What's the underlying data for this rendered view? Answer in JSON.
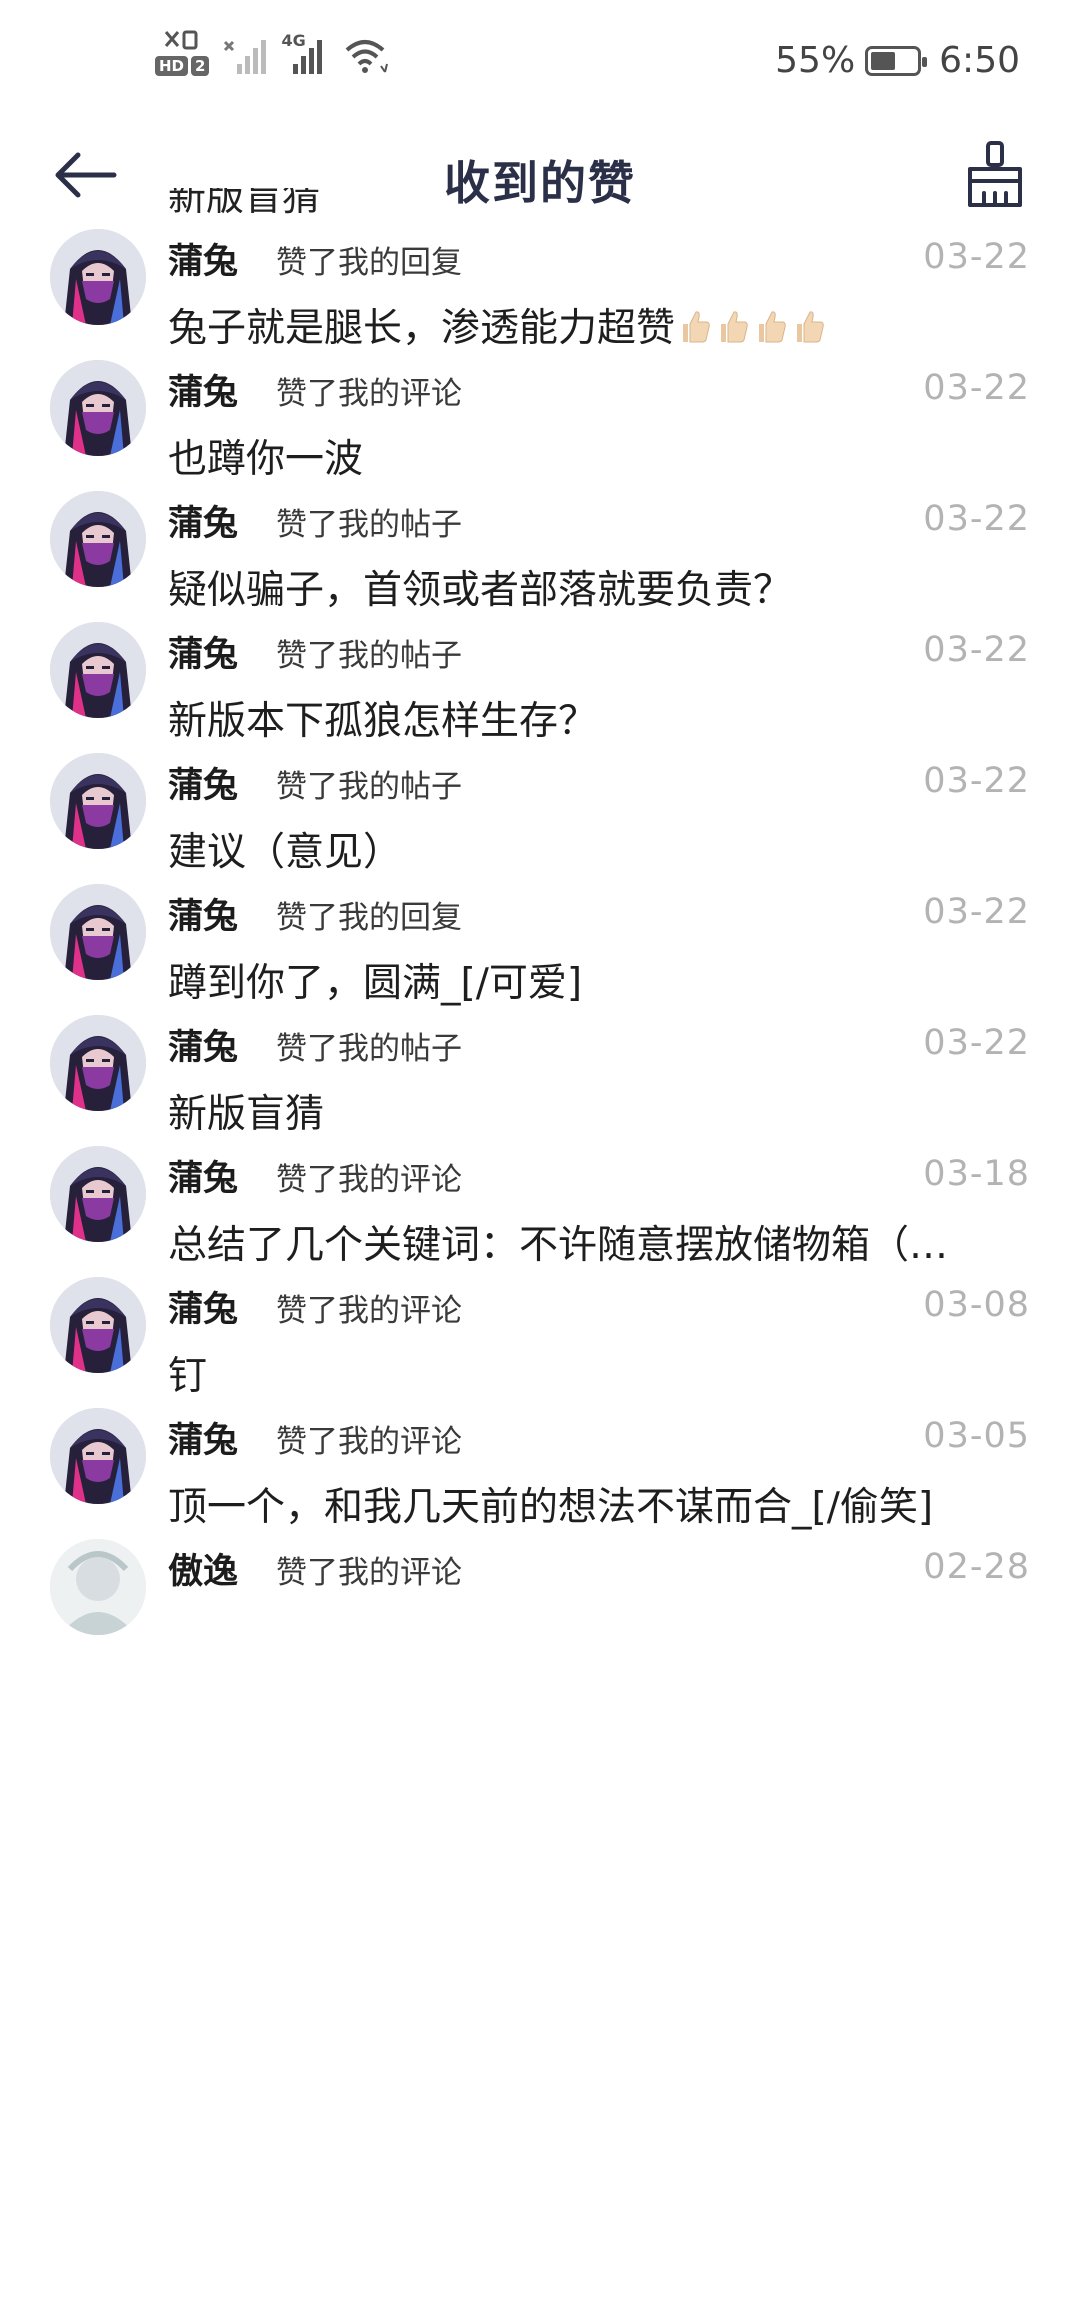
{
  "status_bar": {
    "net_small": "4G",
    "hd_label": "HD",
    "hd_sim": "2",
    "battery_text": "55%",
    "battery_level_percent": 55,
    "time": "6:50"
  },
  "header": {
    "title": "收到的赞",
    "back_icon": "arrow-left-icon",
    "right_icon": "broom-icon"
  },
  "partial_top_text": "新版盲猜",
  "items": [
    {
      "name": "蒲兔",
      "action": "赞了我的回复",
      "date": "03-22",
      "content": "兔子就是腿长，渗透能力超赞",
      "emoji_count": 4,
      "avatar": "dark-hood"
    },
    {
      "name": "蒲兔",
      "action": "赞了我的评论",
      "date": "03-22",
      "content": "也蹲你一波",
      "avatar": "dark-hood"
    },
    {
      "name": "蒲兔",
      "action": "赞了我的帖子",
      "date": "03-22",
      "content": "疑似骗子，首领或者部落就要负责？",
      "avatar": "dark-hood"
    },
    {
      "name": "蒲兔",
      "action": "赞了我的帖子",
      "date": "03-22",
      "content": "新版本下孤狼怎样生存？",
      "avatar": "dark-hood"
    },
    {
      "name": "蒲兔",
      "action": "赞了我的帖子",
      "date": "03-22",
      "content": "建议（意见）",
      "avatar": "dark-hood"
    },
    {
      "name": "蒲兔",
      "action": "赞了我的回复",
      "date": "03-22",
      "content": "蹲到你了，圆满_[/可爱]",
      "avatar": "dark-hood"
    },
    {
      "name": "蒲兔",
      "action": "赞了我的帖子",
      "date": "03-22",
      "content": "新版盲猜",
      "avatar": "dark-hood"
    },
    {
      "name": "蒲兔",
      "action": "赞了我的评论",
      "date": "03-18",
      "content": "总结了几个关键词：不许随意摆放储物箱（…",
      "avatar": "dark-hood"
    },
    {
      "name": "蒲兔",
      "action": "赞了我的评论",
      "date": "03-08",
      "content": "钉",
      "avatar": "dark-hood"
    },
    {
      "name": "蒲兔",
      "action": "赞了我的评论",
      "date": "03-05",
      "content": "顶一个，和我几天前的想法不谋而合_[/偷笑]",
      "avatar": "dark-hood"
    },
    {
      "name": "傲逸",
      "action": "赞了我的评论",
      "date": "02-28",
      "content": "",
      "avatar": "light"
    }
  ],
  "colors": {
    "title": "#2b3048",
    "date": "#b3b3b3",
    "text": "#1e1e1e",
    "avatar_pink": "#e0318a",
    "avatar_blue": "#4a6fd8"
  }
}
